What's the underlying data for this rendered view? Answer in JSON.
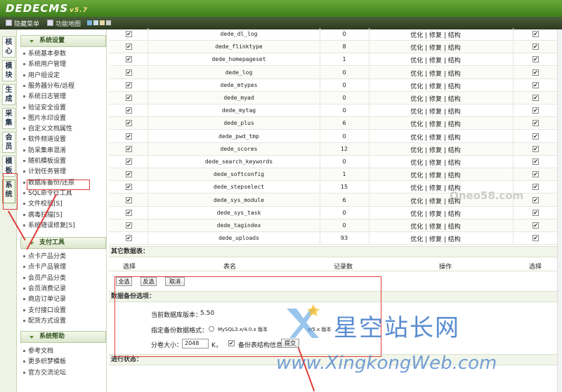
{
  "header": {
    "logo": "DEDECMS",
    "version": "v5.7",
    "hide_menu": "隐藏菜单",
    "func_map": "功能地图"
  },
  "left_tabs": [
    "核心",
    "模块",
    "生成",
    "采集",
    "会员",
    "模板",
    "系统"
  ],
  "menu": {
    "system_title": "系统设置",
    "system_items": [
      "系统基本参数",
      "系统用户管理",
      "用户组设定",
      "服务器分布/远程",
      "系统日志管理",
      "验证安全设置",
      "图片水印设置",
      "自定义文档属性",
      "软件频道设置",
      "防采集串混淆",
      "随机模板设置",
      "计划任务管理",
      "数据库备份/还原",
      "SQL命令行工具",
      "文件校验[S]",
      "病毒扫描[S]",
      "系统错误修复[S]"
    ],
    "pay_title": "支付工具",
    "pay_items": [
      "点卡产品分类",
      "点卡产品管理",
      "会员产品分类",
      "会员消费记录",
      "商店订单记录",
      "支付接口设置",
      "配货方式设置"
    ],
    "help_title": "系统帮助",
    "help_items": [
      "参考文档",
      "更多织梦模板",
      "官方交流论坛"
    ]
  },
  "tables": [
    {
      "name": "dede_dl_log",
      "count": "0"
    },
    {
      "name": "dede_flinktype",
      "count": "8"
    },
    {
      "name": "dede_homepageset",
      "count": "1"
    },
    {
      "name": "dede_log",
      "count": "0"
    },
    {
      "name": "dede_mtypes",
      "count": "0"
    },
    {
      "name": "dede_myad",
      "count": "0"
    },
    {
      "name": "dede_mytag",
      "count": "0"
    },
    {
      "name": "dede_plus",
      "count": "6"
    },
    {
      "name": "dede_pwd_tmp",
      "count": "0"
    },
    {
      "name": "dede_scores",
      "count": "12"
    },
    {
      "name": "dede_search_keywords",
      "count": "0"
    },
    {
      "name": "dede_softconfig",
      "count": "1"
    },
    {
      "name": "dede_stepselect",
      "count": "15"
    },
    {
      "name": "dede_sys_module",
      "count": "6"
    },
    {
      "name": "dede_sys_task",
      "count": "0"
    },
    {
      "name": "dede_tagindex",
      "count": "0"
    },
    {
      "name": "dede_uploads",
      "count": "93"
    }
  ],
  "ops_label": "优化 | 修复 | 结构",
  "other_tables": "其它数据表：",
  "columns": {
    "select": "选择",
    "table": "表名",
    "records": "记录数",
    "action": "操作"
  },
  "buttons": {
    "select_all": "全选",
    "invert": "反选",
    "cancel": "取消",
    "submit": "提交"
  },
  "backup_options": "数据备份选项：",
  "db_version_label": "当前数据库版本：",
  "db_version": "5.50",
  "format_label": "指定备份数据格式：",
  "format_option1": "MySQL3.x/4.0.x 版本",
  "format_option2": "x/5.x 版本",
  "volume_label": "分卷大小：",
  "volume_value": "2048",
  "volume_unit": "K，",
  "struct_label": "备份表结构信息",
  "progress": "进行状态：",
  "watermark": {
    "cn": "星空站长网",
    "en": "www.XingkongWeb.com",
    "ghost": "Oneo58.com"
  }
}
